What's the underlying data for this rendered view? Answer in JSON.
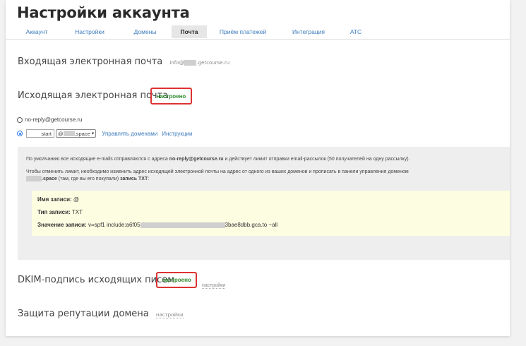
{
  "page": {
    "title": "Настройки аккаунта"
  },
  "tabs": [
    {
      "label": "Аккаунт"
    },
    {
      "label": "Настройки"
    },
    {
      "label": "Домены"
    },
    {
      "label": "Почта"
    },
    {
      "label": "Приём платежей"
    },
    {
      "label": "Интеграция"
    },
    {
      "label": "АТС"
    }
  ],
  "active_tab": "Почта",
  "incoming": {
    "title": "Входящая электронная почта",
    "address_prefix": "info@",
    "address_suffix": ".getcourse.ru"
  },
  "outgoing": {
    "title": "Исходящая электронная почта",
    "status": "настроено",
    "option1": "no-reply@getcourse.ru",
    "option2_input": "start",
    "option2_select_prefix": "@",
    "option2_select_suffix": ".space",
    "manage_link": "Управлять доменами",
    "instructions_link": "Инструкции"
  },
  "info": {
    "p1_before": "По умолчанию все исходящие e-mails отправляются с адреса ",
    "p1_bold": "no-reply@getcourse.ru",
    "p1_after": " и действует лимит отправки email-рассылок (50 получателей на одну рассылку).",
    "p2_line1": "Чтобы отменить лимит, необходимо изменить адрес исходящей электронной почты на адрес от одного из ваших доменов   и прописать в панели управления доменом",
    "p2_bold_domain": ".space",
    "p2_mid": " (там, где вы его покупали) ",
    "p2_bold_end": "запись TXT",
    "p2_end": ":",
    "record_name_label": "Имя записи:",
    "record_name_value": " @",
    "record_type_label": "Тип записи:",
    "record_type_value": " TXT",
    "record_value_label": "Значение записи:",
    "record_value_start": " v=spf1 include:a6f05",
    "record_value_end": "3bae8dbb.gca.to ~all"
  },
  "dkim": {
    "title": "DKIM-подпись исходящих писем",
    "status": "настроено",
    "settings_link": "настройки"
  },
  "reputation": {
    "title": "Защита репутации домена",
    "settings_link": "настройки"
  }
}
